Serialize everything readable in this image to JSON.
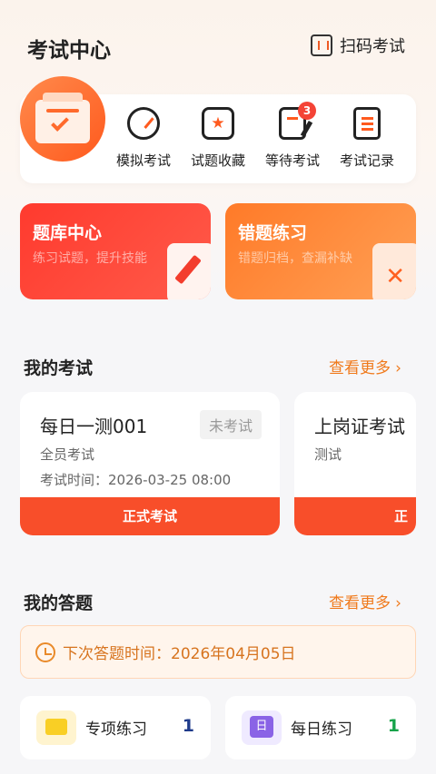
{
  "header": {
    "title": "考试中心",
    "scan_label": "扫码考试"
  },
  "quick_actions": [
    {
      "label": "模拟考试",
      "icon": "gauge-icon"
    },
    {
      "label": "试题收藏",
      "icon": "star-icon"
    },
    {
      "label": "等待考试",
      "icon": "pen-doc-icon",
      "badge": "3"
    },
    {
      "label": "考试记录",
      "icon": "list-doc-icon"
    }
  ],
  "promos": [
    {
      "title": "题库中心",
      "subtitle": "练习试题，提升技能"
    },
    {
      "title": "错题练习",
      "subtitle": "错题归档，查漏补缺"
    }
  ],
  "my_exams": {
    "title": "我的考试",
    "more": "查看更多",
    "cards": [
      {
        "name": "每日一测001",
        "status": "未考试",
        "type": "全员考试",
        "time": "考试时间：2026-03-25 08:00",
        "button": "正式考试"
      },
      {
        "name": "上岗证考试",
        "type": "测试",
        "button": "正式考试"
      }
    ]
  },
  "my_answers": {
    "title": "我的答题",
    "more": "查看更多",
    "next_time": "下次答题时间：2026年04月05日",
    "practice": [
      {
        "label": "专项练习",
        "count": "1",
        "color": "#1e3a8a"
      },
      {
        "label": "每日练习",
        "count": "1",
        "color": "#16a34a"
      }
    ]
  }
}
